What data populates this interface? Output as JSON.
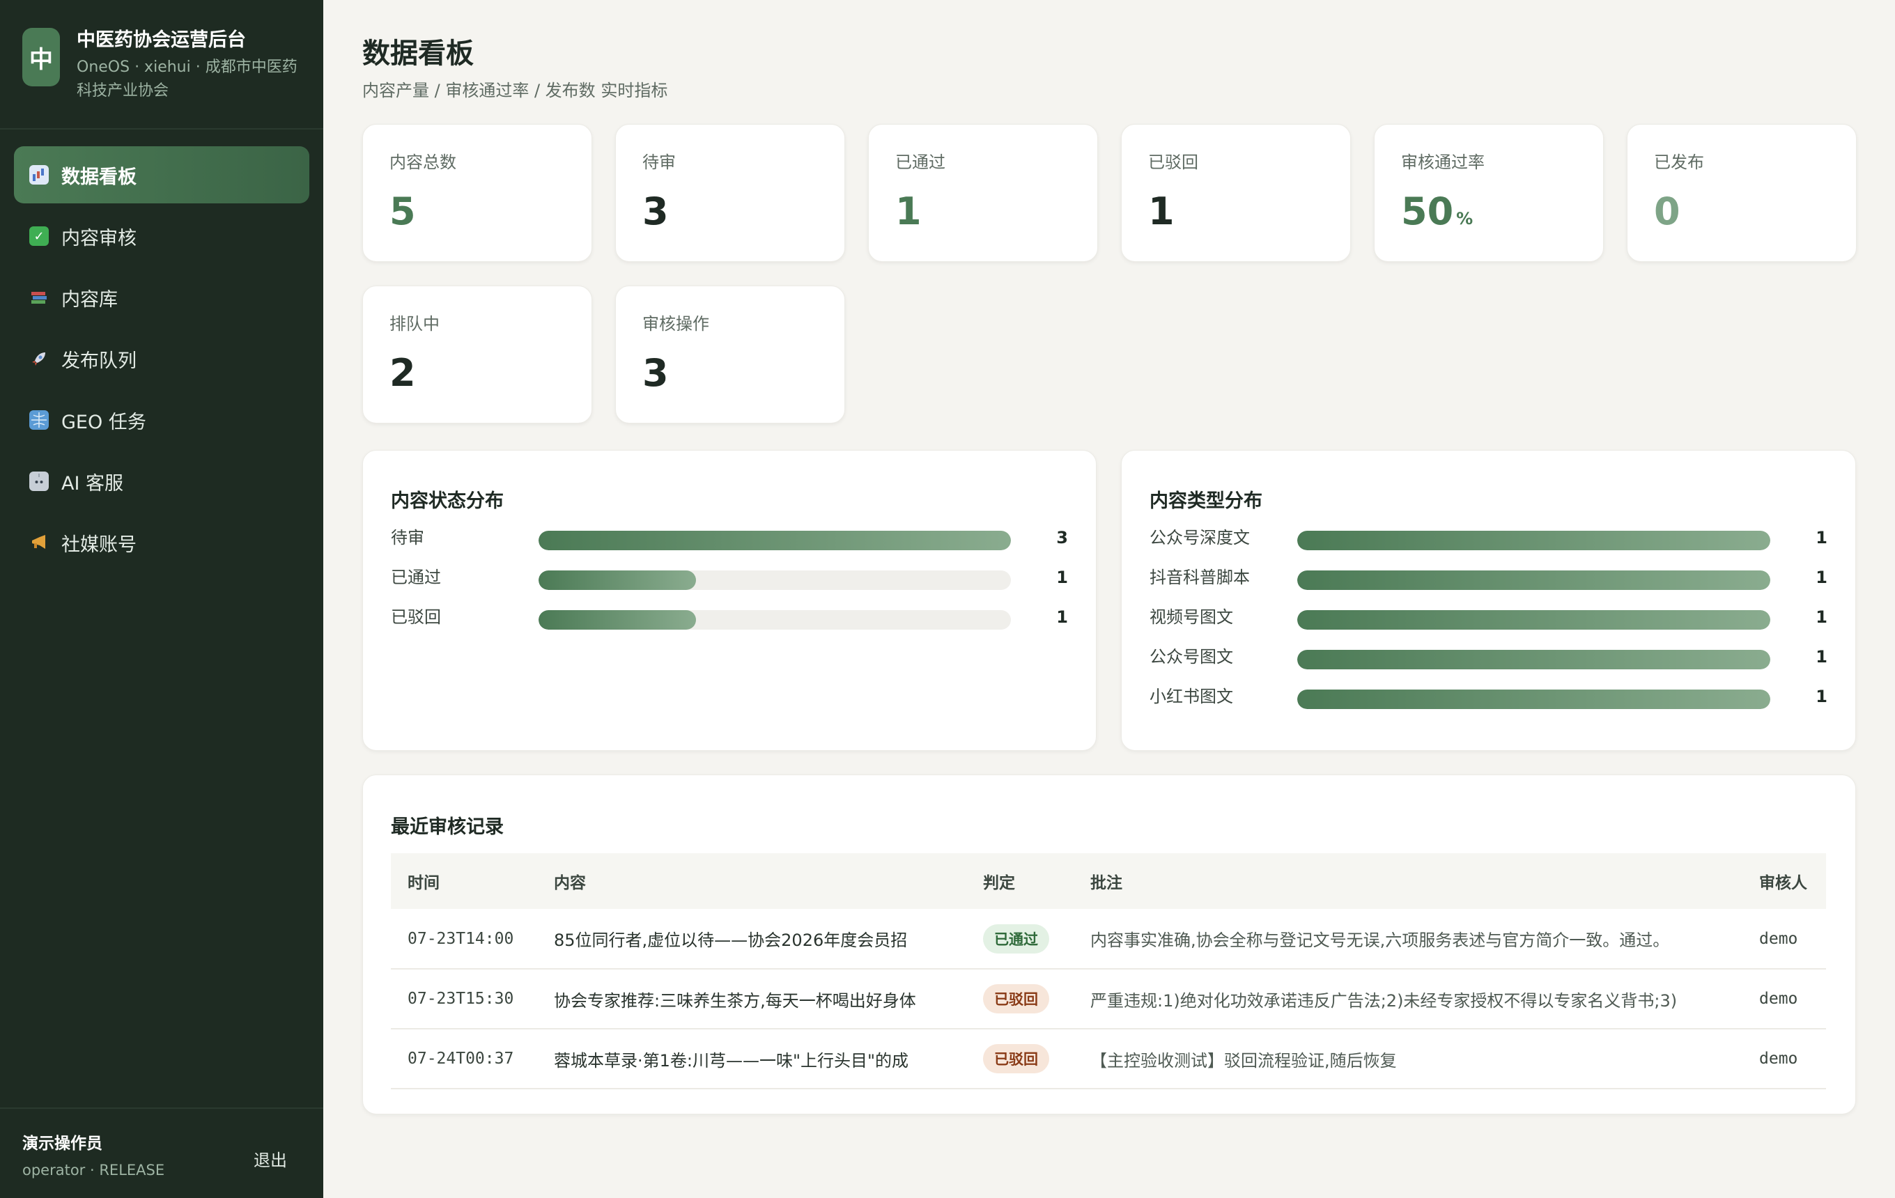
{
  "sidebar": {
    "brand": {
      "logo_char": "中",
      "title": "中医药协会运营后台",
      "subtitle": "OneOS · xiehui · 成都市中医药科技产业协会"
    },
    "items": [
      {
        "label": "数据看板",
        "icon": "bar-chart-icon",
        "active": true
      },
      {
        "label": "内容审核",
        "icon": "check-mark-icon"
      },
      {
        "label": "内容库",
        "icon": "books-icon"
      },
      {
        "label": "发布队列",
        "icon": "rocket-icon"
      },
      {
        "label": "GEO 任务",
        "icon": "globe-icon"
      },
      {
        "label": "AI 客服",
        "icon": "robot-icon"
      },
      {
        "label": "社媒账号",
        "icon": "megaphone-icon"
      }
    ],
    "user": {
      "name": "演示操作员",
      "role": "operator · RELEASE",
      "logout": "退出"
    }
  },
  "header": {
    "title": "数据看板",
    "subtitle": "内容产量 / 审核通过率 / 发布数 实时指标"
  },
  "stats": [
    {
      "label": "内容总数",
      "value": "5"
    },
    {
      "label": "待审",
      "value": "3"
    },
    {
      "label": "已通过",
      "value": "1"
    },
    {
      "label": "已驳回",
      "value": "1"
    },
    {
      "label": "审核通过率",
      "value": "50",
      "unit": "%"
    },
    {
      "label": "已发布",
      "value": "0"
    },
    {
      "label": "排队中",
      "value": "2"
    },
    {
      "label": "审核操作",
      "value": "3"
    }
  ],
  "status_dist": {
    "title": "内容状态分布",
    "rows": [
      {
        "label": "待审",
        "count": "3",
        "fraction": 1.0
      },
      {
        "label": "已通过",
        "count": "1",
        "fraction": 0.333
      },
      {
        "label": "已驳回",
        "count": "1",
        "fraction": 0.333
      }
    ]
  },
  "type_dist": {
    "title": "内容类型分布",
    "rows": [
      {
        "label": "公众号深度文",
        "count": "1",
        "fraction": 1.0
      },
      {
        "label": "抖音科普脚本",
        "count": "1",
        "fraction": 1.0
      },
      {
        "label": "视频号图文",
        "count": "1",
        "fraction": 1.0
      },
      {
        "label": "公众号图文",
        "count": "1",
        "fraction": 1.0
      },
      {
        "label": "小红书图文",
        "count": "1",
        "fraction": 1.0
      }
    ]
  },
  "reviews": {
    "title": "最近审核记录",
    "columns": [
      "时间",
      "内容",
      "判定",
      "批注",
      "审核人"
    ],
    "rows": [
      {
        "time": "07-23T14:00",
        "content": "85位同行者,虚位以待——协会2026年度会员招",
        "verdict": "已通过",
        "verdict_type": "pass",
        "note": "内容事实准确,协会全称与登记文号无误,六项服务表述与官方简介一致。通过。",
        "reviewer": "demo"
      },
      {
        "time": "07-23T15:30",
        "content": "协会专家推荐:三味养生茶方,每天一杯喝出好身体",
        "verdict": "已驳回",
        "verdict_type": "reject",
        "note": "严重违规:1)绝对化功效承诺违反广告法;2)未经专家授权不得以专家名义背书;3)",
        "reviewer": "demo"
      },
      {
        "time": "07-24T00:37",
        "content": "蓉城本草录·第1卷:川芎——一味\"上行头目\"的成",
        "verdict": "已驳回",
        "verdict_type": "reject",
        "note": "【主控验收测试】驳回流程验证,随后恢复",
        "reviewer": "demo"
      }
    ]
  },
  "colors": {
    "sidebar_bg": "#1e2b22",
    "accent": "#4a7a55",
    "page_bg": "#f5f4f0",
    "pass_badge": "#e3f1e4",
    "reject_badge": "#f7e6da"
  }
}
